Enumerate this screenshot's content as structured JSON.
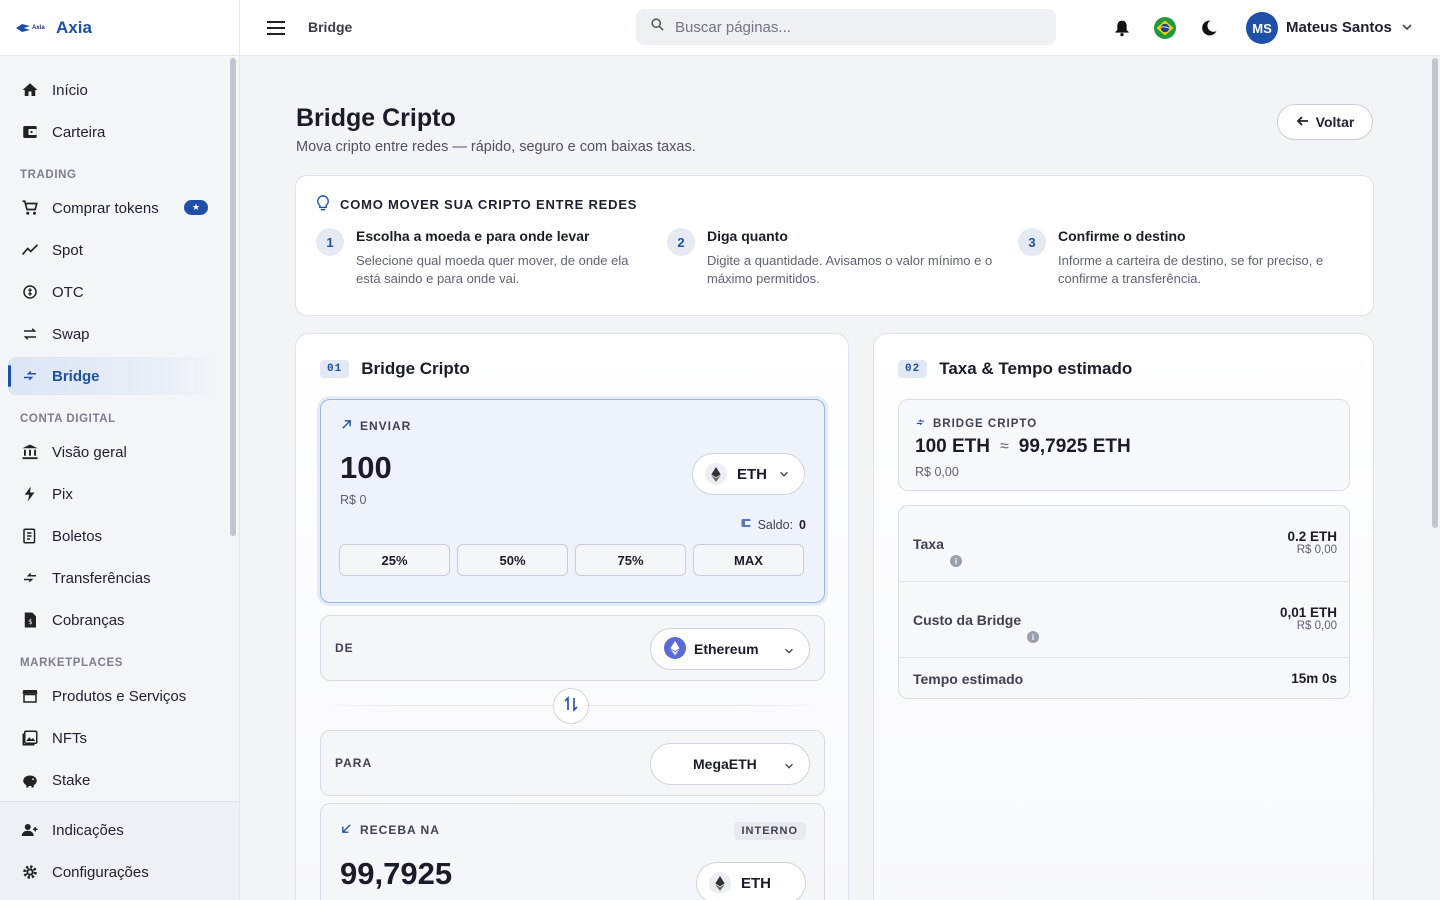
{
  "brand": {
    "logo_text": "Axia",
    "name": "Axia"
  },
  "topbar": {
    "breadcrumb": "Bridge",
    "search_placeholder": "Buscar páginas...",
    "user_initials": "MS",
    "user_name": "Mateus Santos"
  },
  "sidebar": {
    "items_top": [
      {
        "label": "Início",
        "icon": "home-icon"
      },
      {
        "label": "Carteira",
        "icon": "wallet-icon"
      }
    ],
    "section_trading": "TRADING",
    "items_trading": [
      {
        "label": "Comprar tokens",
        "icon": "cart-icon"
      },
      {
        "label": "Spot",
        "icon": "trend-icon"
      },
      {
        "label": "OTC",
        "icon": "otc-icon"
      },
      {
        "label": "Swap",
        "icon": "swap-icon"
      },
      {
        "label": "Bridge",
        "icon": "bridge-icon"
      }
    ],
    "section_conta": "CONTA DIGITAL",
    "items_conta": [
      {
        "label": "Visão geral",
        "icon": "bank-icon"
      },
      {
        "label": "Pix",
        "icon": "bolt-icon"
      },
      {
        "label": "Boletos",
        "icon": "receipt-icon"
      },
      {
        "label": "Transferências",
        "icon": "transfer-icon"
      },
      {
        "label": "Cobranças",
        "icon": "invoice-icon"
      }
    ],
    "section_market": "MARKETPLACES",
    "items_market": [
      {
        "label": "Produtos e Serviços",
        "icon": "store-icon"
      },
      {
        "label": "NFTs",
        "icon": "image-icon"
      },
      {
        "label": "Stake",
        "icon": "piggy-icon"
      }
    ],
    "items_bottom": [
      {
        "label": "Indicações",
        "icon": "add-user-icon"
      },
      {
        "label": "Configurações",
        "icon": "gear-icon"
      }
    ]
  },
  "page": {
    "title": "Bridge Cripto",
    "subtitle": "Mova cripto entre redes — rápido, seguro e com baixas taxas.",
    "back_label": "Voltar"
  },
  "how": {
    "title": "COMO MOVER SUA CRIPTO ENTRE REDES",
    "steps": [
      {
        "num": "1",
        "title": "Escolha a moeda e para onde levar",
        "desc": "Selecione qual moeda quer mover, de onde ela está saindo e para onde vai."
      },
      {
        "num": "2",
        "title": "Diga quanto",
        "desc": "Digite a quantidade. Avisamos o valor mínimo e o máximo permitidos."
      },
      {
        "num": "3",
        "title": "Confirme o destino",
        "desc": "Informe a carteira de destino, se for preciso, e confirme a transferência."
      }
    ]
  },
  "bridge": {
    "chip": "01",
    "title": "Bridge Cripto",
    "send_label": "ENVIAR",
    "send_amount": "100",
    "send_fiat": "R$ 0",
    "token": "ETH",
    "saldo_label": "Saldo:",
    "saldo_value": "0",
    "pct": [
      "25%",
      "50%",
      "75%",
      "MAX"
    ],
    "from_label": "DE",
    "from_network": "Ethereum",
    "to_label": "PARA",
    "to_network": "MegaETH",
    "recv_label": "RECEBA NA",
    "recv_badge": "INTERNO",
    "recv_amount": "99,7925",
    "recv_token": "ETH"
  },
  "fees": {
    "chip": "02",
    "title": "Taxa & Tempo estimado",
    "summary_label": "BRIDGE CRIPTO",
    "summary_from": "100 ETH",
    "summary_approx": "≈",
    "summary_to": "99,7925 ETH",
    "summary_fiat": "R$ 0,00",
    "rows": [
      {
        "name": "Taxa",
        "value": "0.2 ETH",
        "fiat": "R$ 0,00"
      },
      {
        "name": "Custo da Bridge",
        "value": "0,01 ETH",
        "fiat": "R$ 0,00"
      },
      {
        "name": "Tempo estimado",
        "value": "15m 0s"
      }
    ]
  },
  "colors": {
    "accent": "#1f4fa6",
    "sidebar_bg": "#f4f5f8",
    "send_box_bg": "#eef3fb"
  }
}
